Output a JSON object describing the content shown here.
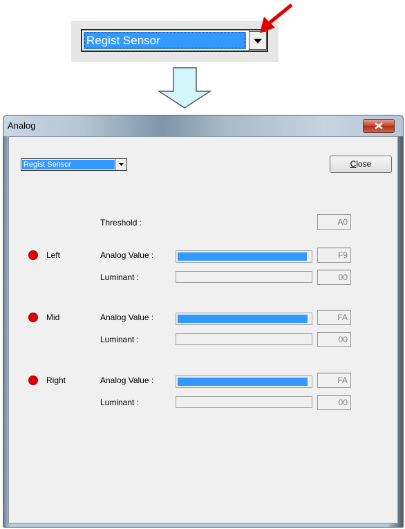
{
  "zoom": {
    "combo_value": "Regist Sensor",
    "dropdown_icon": "triangle-down-icon",
    "pointer_icon": "red-arrow-icon"
  },
  "transition_icon": "down-arrow-icon",
  "window": {
    "title": "Analog",
    "close_icon": "close-x-icon",
    "combo_value": "Regist Sensor",
    "close_button_label": "Close",
    "threshold_label": "Threshold :",
    "threshold_value": "A0",
    "analog_label": "Analog Value :",
    "luminant_label": "Luminant :",
    "sensors": [
      {
        "name": "Left",
        "analog": "F9",
        "analog_fraction": 0.976,
        "luminant": "00",
        "luminant_fraction": 0,
        "status_color": "#e00000"
      },
      {
        "name": "Mid",
        "analog": "FA",
        "analog_fraction": 0.98,
        "luminant": "00",
        "luminant_fraction": 0,
        "status_color": "#e00000"
      },
      {
        "name": "Right",
        "analog": "FA",
        "analog_fraction": 0.98,
        "luminant": "00",
        "luminant_fraction": 0,
        "status_color": "#e00000"
      }
    ]
  }
}
